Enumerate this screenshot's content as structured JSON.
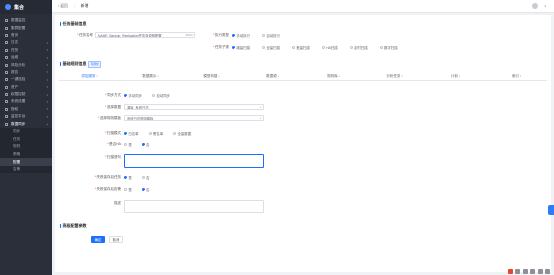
{
  "app": {
    "logo_text": "集合"
  },
  "sidebar": {
    "items": [
      {
        "label": "数据监控",
        "caret": ""
      },
      {
        "label": "集群配置",
        "caret": ""
      },
      {
        "label": "首页",
        "caret": ""
      },
      {
        "label": "日志",
        "caret": "▾"
      },
      {
        "label": "任务",
        "caret": "▾"
      },
      {
        "label": "运维",
        "caret": "▾"
      },
      {
        "label": "风险分析",
        "caret": "▾"
      },
      {
        "label": "报告",
        "caret": "▾"
      },
      {
        "label": "一键巡检",
        "caret": "▾"
      },
      {
        "label": "资产",
        "caret": "▾"
      },
      {
        "label": "权限控制",
        "caret": "▾"
      },
      {
        "label": "系统设置",
        "caret": "▾"
      },
      {
        "label": "授权",
        "caret": "▾"
      },
      {
        "label": "监控平台",
        "caret": "▾"
      },
      {
        "label": "数据同步",
        "caret": "▴"
      }
    ],
    "subitems": [
      {
        "label": "同步"
      },
      {
        "label": "任务"
      },
      {
        "label": "规则"
      },
      {
        "label": "策略"
      },
      {
        "label": "配置"
      },
      {
        "label": "告警"
      }
    ]
  },
  "topbar": {
    "back_label": "返回",
    "title": "新增",
    "user_caret": "▾"
  },
  "section_basic": {
    "title": "任务基础信息"
  },
  "fields": {
    "task_name": {
      "label": "任务名称",
      "value": "NAME_Backup_Replication任务及说明配置",
      "count": "26/64"
    },
    "exec_type": {
      "label": "执行类型",
      "options": [
        "手动执行",
        "自动执行"
      ]
    },
    "scan_type": {
      "label": "任务子类",
      "options": [
        "增量扫描",
        "全量扫描",
        "差量扫描",
        "HA扫描",
        "定时扫描",
        "数字扫描"
      ]
    }
  },
  "section_rule": {
    "title": "基础规则信息",
    "tag": "可视化"
  },
  "tabs": [
    {
      "label": "供应服务"
    },
    {
      "label": "数据展示"
    },
    {
      "label": "模型构建"
    },
    {
      "label": "数据源"
    },
    {
      "label": "规则库"
    },
    {
      "label": "分析任务"
    },
    {
      "label": "计划"
    },
    {
      "label": "索引"
    }
  ],
  "rule_fields": {
    "sync_method": {
      "label": "同步方式",
      "options": [
        "手动同步",
        "自动同步"
      ]
    },
    "source_db": {
      "label": "选择数据",
      "value": "源库_系统日志"
    },
    "target_rule": {
      "label": "选择规则模板",
      "value": "系统日志规则模板"
    },
    "scan_mode": {
      "label": "扫描模式",
      "options": [
        "白名单",
        "黑名单",
        "全量数据"
      ]
    },
    "enable_ha": {
      "label": "是否HA",
      "options": [
        "是",
        "否"
      ]
    },
    "scan_script": {
      "label": "扫描语句",
      "value": ""
    },
    "save_on_fail": {
      "label": "失败保存后任务",
      "options": [
        "是",
        "否"
      ]
    },
    "notify_on_fail": {
      "label": "失败保存后告警",
      "options": [
        "是",
        "否"
      ]
    },
    "description": {
      "label": "描述",
      "value": ""
    }
  },
  "section_advanced": {
    "title": "高级配置参数"
  },
  "actions": {
    "submit_label": "确定",
    "cancel_label": "取消"
  },
  "colors": {
    "accent": "#1e6fff",
    "sidebar_bg": "#2b2f3a"
  }
}
